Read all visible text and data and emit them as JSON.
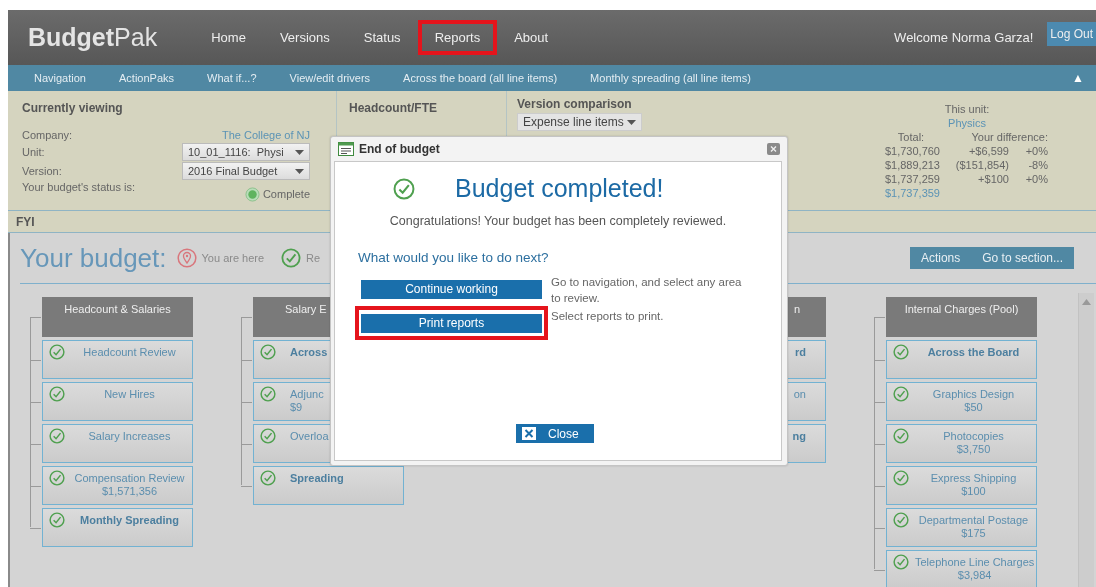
{
  "header": {
    "logo": "**Budget**Pak",
    "nav": [
      {
        "label": "Home",
        "highlighted": false
      },
      {
        "label": "Versions",
        "highlighted": false
      },
      {
        "label": "Status",
        "highlighted": false
      },
      {
        "label": "Reports",
        "highlighted": true
      },
      {
        "label": "About",
        "highlighted": false
      }
    ],
    "welcome": "Welcome Norma Garza!",
    "logout": "Log Out"
  },
  "subnav": {
    "items": [
      "Navigation",
      "ActionPaks",
      "What if...?",
      "View/edit drivers",
      "Across the board (all line items)",
      "Monthly spreading (all line items)"
    ],
    "collapse": "▲"
  },
  "currently_viewing": {
    "title": "Currently viewing",
    "company_label": "Company:",
    "company": "The College of NJ",
    "unit_label": "Unit:",
    "unit": "10_01_1116:  Physi",
    "version_label": "Version:",
    "version": "2016 Final Budget",
    "status_label": "Your budget's status is:",
    "status": "Complete"
  },
  "headcount": {
    "title": "Headcount/FTE"
  },
  "version_comparison": {
    "title": "Version comparison",
    "selection": "Expense line items"
  },
  "unit_summary": {
    "label": "This unit:",
    "unit": "Physics",
    "total_label": "Total:",
    "difference_label": "Your difference:",
    "rows": [
      {
        "kind": "comparison",
        "total": "$1,730,760",
        "difference": "+$6,599",
        "percent": "+0%"
      },
      {
        "kind": "comparison",
        "total": "$1,889,213",
        "difference": "($151,854)",
        "percent": "-8%"
      },
      {
        "kind": "comparison",
        "total": "$1,737,259",
        "difference": "+$100",
        "percent": "+0%"
      },
      {
        "kind": "current",
        "total": "$1,737,359"
      }
    ]
  },
  "fyi": "FYI",
  "board": {
    "title": "Your budget:",
    "legend": [
      {
        "kind": "location",
        "label": "You are here"
      },
      {
        "kind": "reviewed",
        "label": "Re"
      }
    ],
    "actions": [
      "Actions",
      "Go to section..."
    ],
    "columns": [
      {
        "kind": "full",
        "title": "Headcount & Salaries",
        "items": [
          {
            "label": "Headcount Review",
            "bold": false,
            "reviewed": true
          },
          {
            "label": "New Hires",
            "bold": false,
            "reviewed": true
          },
          {
            "label": "Salary Increases",
            "bold": false,
            "reviewed": true
          },
          {
            "label": "Compensation Review",
            "amount": "$1,571,356",
            "bold": false,
            "reviewed": true
          },
          {
            "label": "Monthly Spreading",
            "bold": true,
            "reviewed": true
          }
        ]
      },
      {
        "kind": "cut_right",
        "title": "Salary E",
        "items": [
          {
            "label": "Across",
            "bold": true,
            "reviewed": true
          },
          {
            "label": "Adjunc",
            "amount": "$9",
            "bold": false,
            "reviewed": true
          },
          {
            "label": "Overloa",
            "bold": false,
            "reviewed": true
          },
          {
            "label": "Spreading",
            "bold": true,
            "reviewed": true
          }
        ]
      },
      {
        "kind": "cut_left",
        "title": "n",
        "items": [
          {
            "label": "rd",
            "bold": true
          },
          {
            "label": "on",
            "bold": false
          },
          {
            "label": "ng",
            "bold": true
          }
        ]
      },
      {
        "kind": "full",
        "title": "Internal Charges (Pool)",
        "items": [
          {
            "label": "Across the Board",
            "bold": true,
            "reviewed": true
          },
          {
            "label": "Graphics Design",
            "amount": "$50",
            "bold": false,
            "reviewed": true
          },
          {
            "label": "Photocopies",
            "amount": "$3,750",
            "bold": false,
            "reviewed": true
          },
          {
            "label": "Express Shipping",
            "amount": "$100",
            "bold": false,
            "reviewed": true
          },
          {
            "label": "Departmental Postage",
            "amount": "$175",
            "bold": false,
            "reviewed": true
          },
          {
            "label": "Telephone Line Charges",
            "amount": "$3,984",
            "bold": false,
            "reviewed": true
          }
        ]
      }
    ]
  },
  "modal": {
    "title": "End of budget",
    "heading": "Budget completed!",
    "message": "Congratulations! Your budget has been completely reviewed.",
    "prompt": "What would you like to do next?",
    "actions": [
      {
        "label": "Continue working",
        "description": "Go to navigation, and select any area to review.",
        "highlighted": false
      },
      {
        "label": "Print reports",
        "description": "Select reports to print.",
        "highlighted": true
      }
    ],
    "close": "Close"
  }
}
